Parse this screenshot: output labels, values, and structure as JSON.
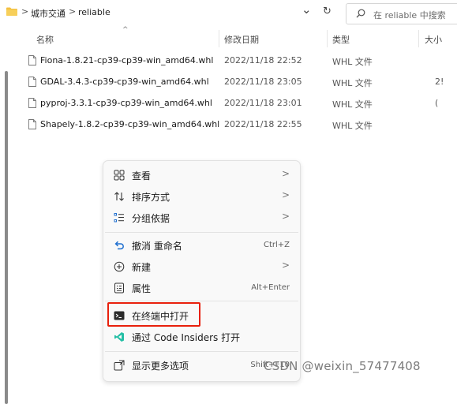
{
  "breadcrumb": {
    "items": [
      "城市交通",
      "reliable"
    ],
    "separator": ">"
  },
  "toolbar": {
    "dropdown_glyph": "⌄",
    "refresh_glyph": "↻",
    "search_placeholder": "在 reliable 中搜索"
  },
  "columns": {
    "name": "名称",
    "date": "修改日期",
    "type": "类型",
    "size": "大小",
    "sort_indicator": "^"
  },
  "files": [
    {
      "name": "Fiona-1.8.21-cp39-cp39-win_amd64.whl",
      "date": "2022/11/18 22:52",
      "type": "WHL 文件",
      "size": ""
    },
    {
      "name": "GDAL-3.4.3-cp39-cp39-win_amd64.whl",
      "date": "2022/11/18 23:05",
      "type": "WHL 文件",
      "size": "2!"
    },
    {
      "name": "pyproj-3.3.1-cp39-cp39-win_amd64.whl",
      "date": "2022/11/18 23:01",
      "type": "WHL 文件",
      "size": "("
    },
    {
      "name": "Shapely-1.8.2-cp39-cp39-win_amd64.whl",
      "date": "2022/11/18 22:55",
      "type": "WHL 文件",
      "size": ""
    }
  ],
  "context_menu": {
    "items": [
      {
        "label": "查看",
        "icon": "view-grid-icon",
        "shortcut": "",
        "submenu": true
      },
      {
        "label": "排序方式",
        "icon": "sort-icon",
        "shortcut": "",
        "submenu": true
      },
      {
        "label": "分组依据",
        "icon": "group-icon",
        "shortcut": "",
        "submenu": true
      },
      {
        "label": "撤消 重命名",
        "icon": "undo-icon",
        "shortcut": "Ctrl+Z",
        "submenu": false
      },
      {
        "label": "新建",
        "icon": "new-plus-icon",
        "shortcut": "",
        "submenu": true
      },
      {
        "label": "属性",
        "icon": "properties-icon",
        "shortcut": "Alt+Enter",
        "submenu": false
      },
      {
        "label": "在终端中打开",
        "icon": "terminal-icon",
        "shortcut": "",
        "submenu": false
      },
      {
        "label": "通过 Code Insiders 打开",
        "icon": "vscode-insiders-icon",
        "shortcut": "",
        "submenu": false
      },
      {
        "label": "显示更多选项",
        "icon": "more-options-icon",
        "shortcut": "Shift+F10",
        "submenu": false
      }
    ],
    "submenu_glyph": ">"
  },
  "colors": {
    "highlight_box": "#e8200c",
    "folder": "#f4c03f",
    "undo_icon": "#1f6fd0",
    "vscode_insiders": "#24bfa5"
  },
  "watermark": "CSDN @weixin_57477408"
}
